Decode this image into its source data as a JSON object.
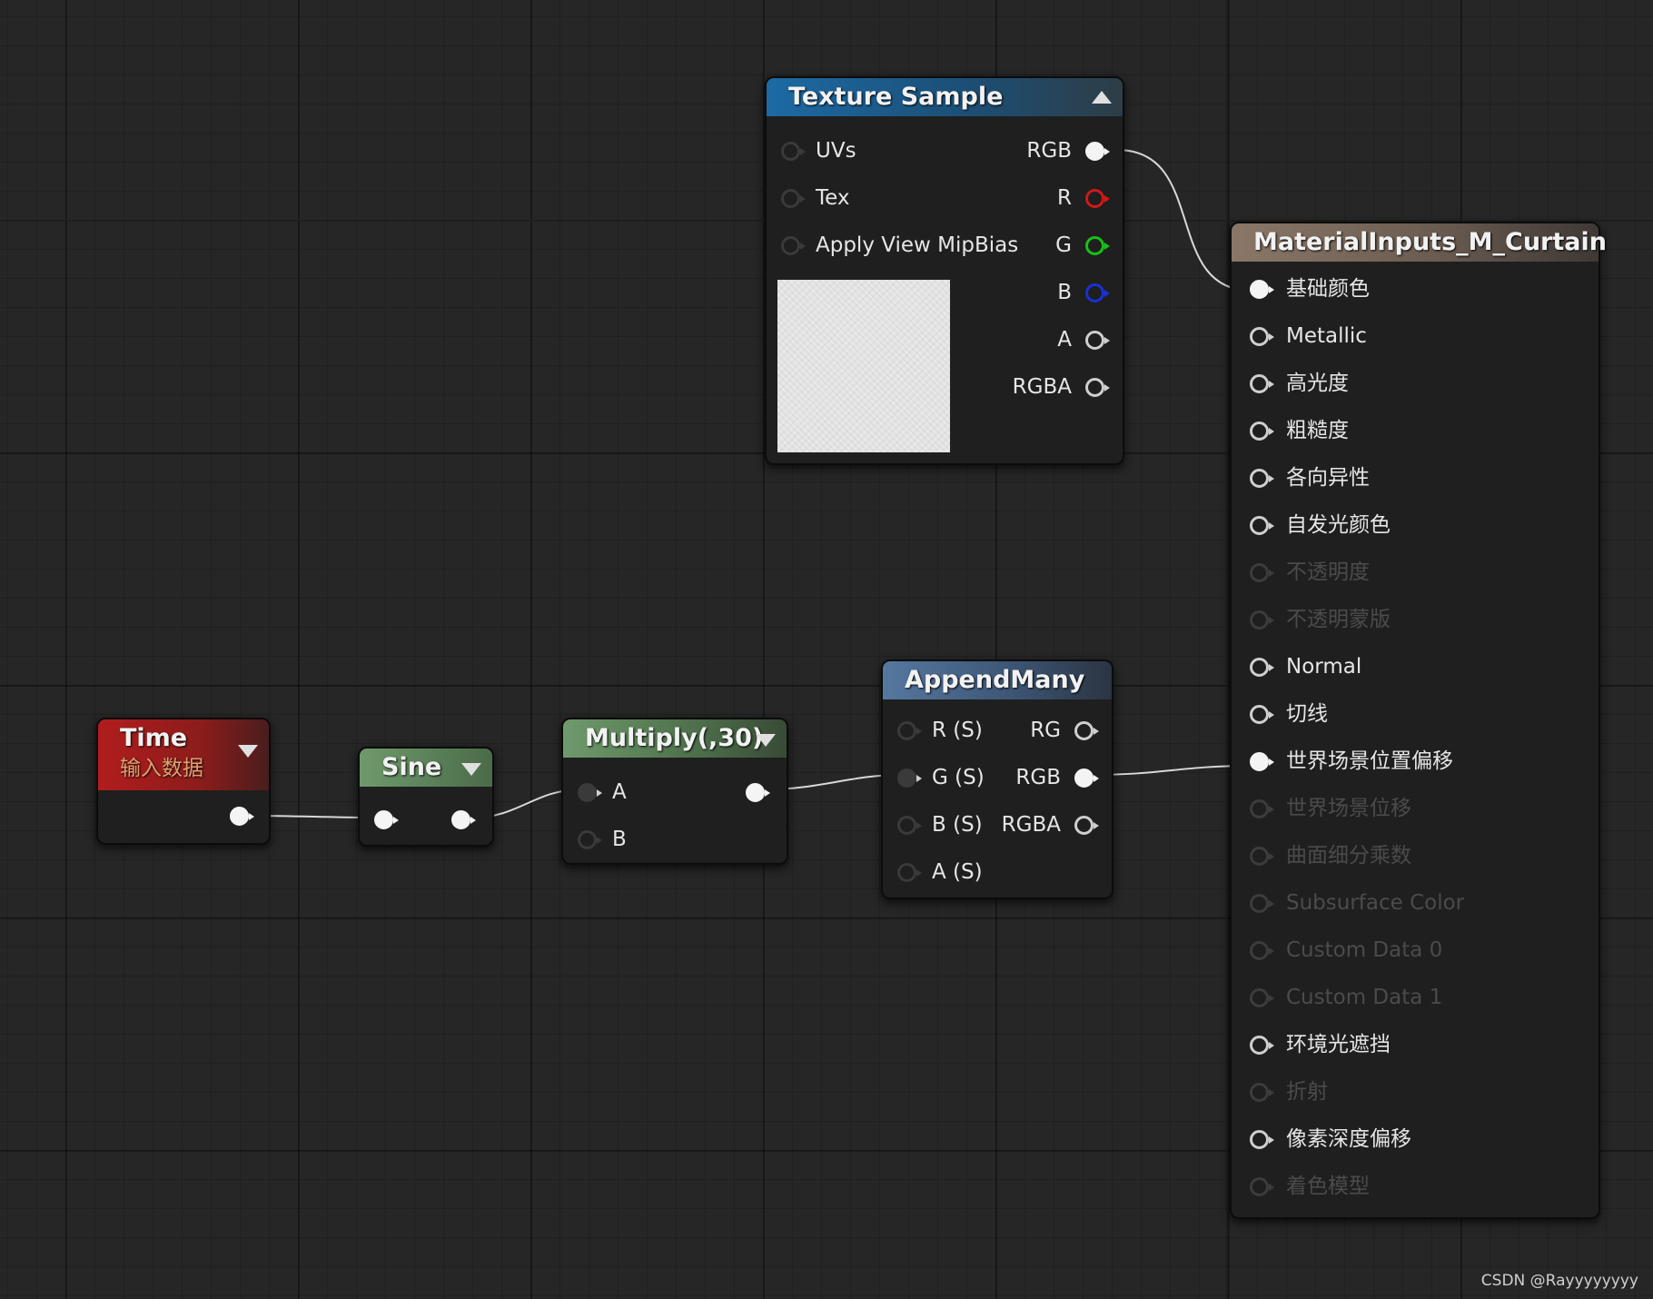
{
  "nodes": {
    "texture_sample": {
      "title": "Texture Sample",
      "inputs": [
        "UVs",
        "Tex",
        "Apply View MipBias"
      ],
      "outputs": [
        "RGB",
        "R",
        "G",
        "B",
        "A",
        "RGBA"
      ]
    },
    "material_inputs": {
      "title": "MaterialInputs_M_Curtain",
      "inputs": [
        {
          "label": "基础颜色",
          "enabled": true
        },
        {
          "label": "Metallic",
          "enabled": true
        },
        {
          "label": "高光度",
          "enabled": true
        },
        {
          "label": "粗糙度",
          "enabled": true
        },
        {
          "label": "各向异性",
          "enabled": true
        },
        {
          "label": "自发光颜色",
          "enabled": true
        },
        {
          "label": "不透明度",
          "enabled": false
        },
        {
          "label": "不透明蒙版",
          "enabled": false
        },
        {
          "label": "Normal",
          "enabled": true
        },
        {
          "label": "切线",
          "enabled": true
        },
        {
          "label": "世界场景位置偏移",
          "enabled": true
        },
        {
          "label": "世界场景位移",
          "enabled": false
        },
        {
          "label": "曲面细分乘数",
          "enabled": false
        },
        {
          "label": "Subsurface Color",
          "enabled": false
        },
        {
          "label": "Custom Data 0",
          "enabled": false
        },
        {
          "label": "Custom Data 1",
          "enabled": false
        },
        {
          "label": "环境光遮挡",
          "enabled": true
        },
        {
          "label": "折射",
          "enabled": false
        },
        {
          "label": "像素深度偏移",
          "enabled": true
        },
        {
          "label": "着色模型",
          "enabled": false
        }
      ]
    },
    "time": {
      "title": "Time",
      "subtitle": "输入数据"
    },
    "sine": {
      "title": "Sine"
    },
    "multiply": {
      "title": "Multiply(,30)",
      "inputs": [
        "A",
        "B"
      ]
    },
    "append_many": {
      "title": "AppendMany",
      "inputs": [
        "R (S)",
        "G (S)",
        "B (S)",
        "A (S)"
      ],
      "outputs": [
        "RG",
        "RGB",
        "RGBA"
      ]
    }
  },
  "colors": {
    "texture_header": "#1d6aa4",
    "material_header": "#8a7767",
    "append_header": "#5578a0",
    "time_header": "#b11d1d",
    "math_header": "#6f9a6c",
    "pin_r": "#d01818",
    "pin_g": "#18c018",
    "pin_b": "#1830d8"
  },
  "watermark": "CSDN @Rayyyyyyyy"
}
